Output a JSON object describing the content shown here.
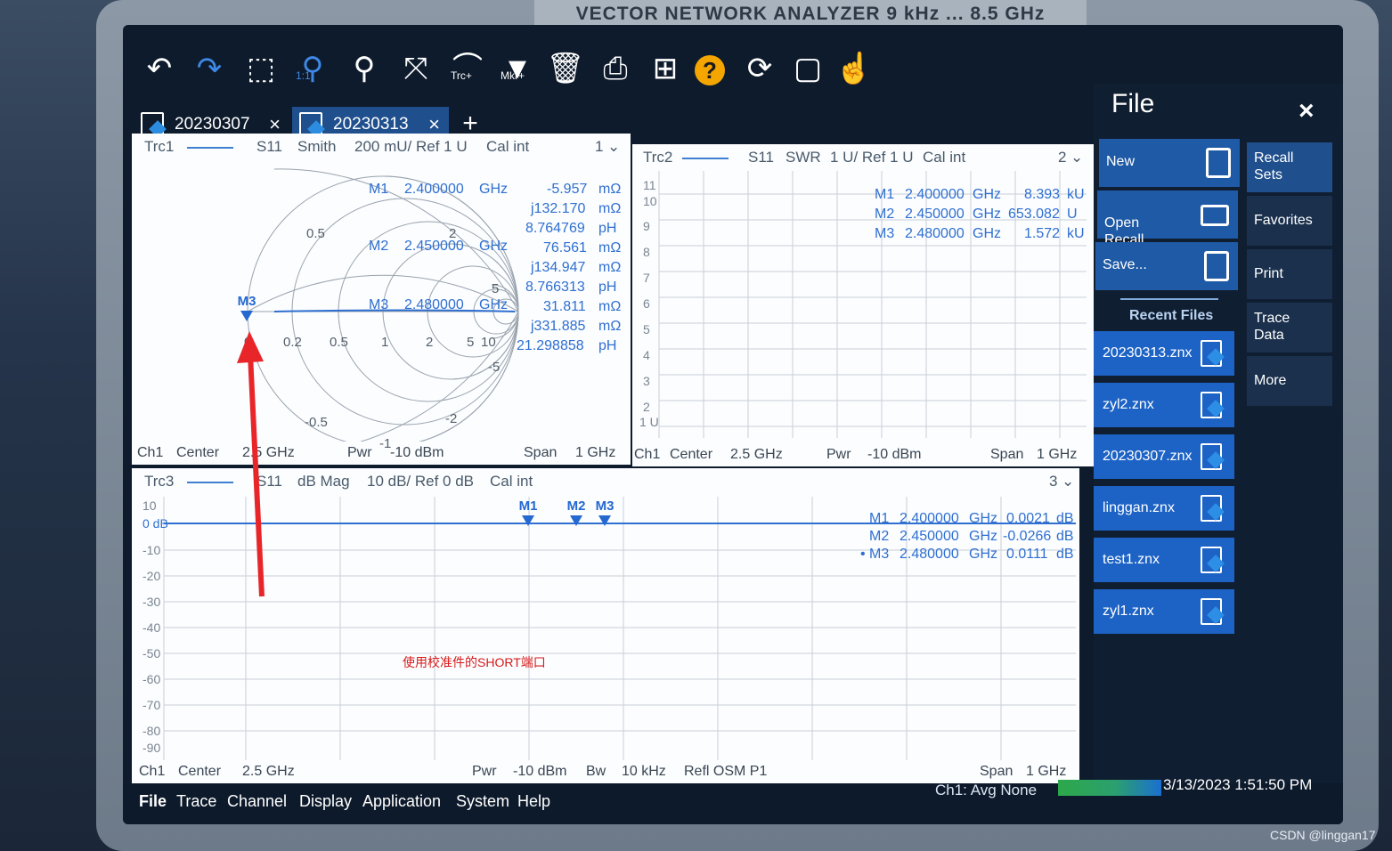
{
  "instrument_title": "VECTOR NETWORK ANALYZER  9 kHz ... 8.5 GHz",
  "toolbar": {
    "undo": "undo-icon",
    "redo": "redo-icon",
    "zoom_select": "zoom-select-icon",
    "zoom_reset": "zoom-reset-icon",
    "zoom_reset_label": "1:1",
    "zoom_settings": "zoom-settings-icon",
    "fullscreen": "fullscreen-icon",
    "trace_add_label": "Trc+",
    "marker_add_label": "Mkr+",
    "delete": "trash-icon",
    "print": "print-icon",
    "windows": "windows-icon",
    "help": "?",
    "refresh": "refresh-icon",
    "window": "window-icon",
    "touch": "touch-icon"
  },
  "tabs": [
    {
      "label": "20230307",
      "close": "×"
    },
    {
      "label": "20230313",
      "close": "×",
      "active": true
    }
  ],
  "tab_add": "+",
  "trc1": {
    "name": "Trc1",
    "meas": "S11",
    "format": "Smith",
    "scale": "200 mU/ Ref 1 U",
    "cal": "Cal int",
    "window": "1",
    "smith_labels": {
      "r0": "0",
      "r02": "0.2",
      "r05": "0.5",
      "r1": "1",
      "r2": "2",
      "r5": "5",
      "r10": "10",
      "x05": "0.5",
      "x2": "2",
      "x5": "5",
      "xm05": "-0.5",
      "xm2": "-2",
      "xm5": "-5",
      "xm1": "-1"
    },
    "markers": [
      {
        "name": "M1",
        "freq": "2.400000",
        "unit": "GHz",
        "r": "-5.957",
        "r_unit": "mΩ",
        "x": "j132.170",
        "x_unit": "mΩ",
        "l": "8.764769",
        "l_unit": "pH"
      },
      {
        "name": "M2",
        "freq": "2.450000",
        "unit": "GHz",
        "r": "76.561",
        "r_unit": "mΩ",
        "x": "j134.947",
        "x_unit": "mΩ",
        "l": "8.766313",
        "l_unit": "pH"
      },
      {
        "name": "M3",
        "freq": "2.480000",
        "unit": "GHz",
        "r": "31.811",
        "r_unit": "mΩ",
        "x": "j331.885",
        "x_unit": "mΩ",
        "l": "21.298858",
        "l_unit": "pH"
      }
    ],
    "marker_flag": "M3",
    "footer": {
      "ch": "Ch1",
      "center_label": "Center",
      "center": "2.5 GHz",
      "pwr_label": "Pwr",
      "pwr": "-10 dBm",
      "span_label": "Span",
      "span": "1 GHz"
    }
  },
  "trc2": {
    "name": "Trc2",
    "meas": "S11",
    "format": "SWR",
    "scale": "1 U/ Ref 1 U",
    "cal": "Cal int",
    "window": "2",
    "y_ticks": [
      "11",
      "10",
      "9",
      "8",
      "7",
      "6",
      "5",
      "4",
      "3",
      "2",
      "1 U"
    ],
    "markers": [
      {
        "name": "M1",
        "freq": "2.400000",
        "unit": "GHz",
        "value": "8.393",
        "v_unit": "kU"
      },
      {
        "name": "M2",
        "freq": "2.450000",
        "unit": "GHz",
        "value": "653.082",
        "v_unit": "U"
      },
      {
        "name": "M3",
        "freq": "2.480000",
        "unit": "GHz",
        "value": "1.572",
        "v_unit": "kU"
      }
    ],
    "footer": {
      "ch": "Ch1",
      "center_label": "Center",
      "center": "2.5 GHz",
      "pwr_label": "Pwr",
      "pwr": "-10 dBm",
      "span_label": "Span",
      "span": "1 GHz"
    }
  },
  "trc3": {
    "name": "Trc3",
    "meas": "S11",
    "format": "dB Mag",
    "scale": "10 dB/ Ref 0 dB",
    "cal": "Cal int",
    "window": "3",
    "y_ticks": [
      "10",
      "0 dB",
      "-10",
      "-20",
      "-30",
      "-40",
      "-50",
      "-60",
      "-70",
      "-80",
      "-90"
    ],
    "marker_flags": [
      "M1",
      "M2",
      "M3"
    ],
    "markers": [
      {
        "name": "M1",
        "freq": "2.400000",
        "unit": "GHz",
        "value": "0.0021",
        "v_unit": "dB"
      },
      {
        "name": "M2",
        "freq": "2.450000",
        "unit": "GHz",
        "value": "-0.0266",
        "v_unit": "dB"
      },
      {
        "name": "M3",
        "freq": "2.480000",
        "unit": "GHz",
        "value": "0.0111",
        "v_unit": "dB",
        "active": "•"
      }
    ],
    "footer": {
      "ch": "Ch1",
      "center_label": "Center",
      "center": "2.5 GHz",
      "pwr_label": "Pwr",
      "pwr": "-10 dBm",
      "bw_label": "Bw",
      "bw": "10 kHz",
      "refl": "Refl OSM P1",
      "span_label": "Span",
      "span": "1 GHz"
    }
  },
  "annotation": "使用校准件的SHORT端口",
  "file_panel": {
    "title": "File",
    "close": "×",
    "new": "New",
    "open": "Open\nRecall...",
    "save": "Save...",
    "recent_header": "Recent Files",
    "recent_files": [
      "20230313.znx",
      "zyl2.znx",
      "20230307.znx",
      "linggan.znx",
      "test1.znx",
      "zyl1.znx"
    ],
    "right_buttons": [
      "Recall\nSets",
      "Favorites",
      "Print",
      "Trace\nData",
      "More"
    ]
  },
  "menubar": [
    "File",
    "Trace",
    "Channel",
    "Display",
    "Application",
    "System",
    "Help"
  ],
  "status": {
    "avg": "Ch1: Avg None",
    "datetime": "3/13/2023 1:51:50 PM"
  },
  "watermark": "CSDN @linggan17",
  "colors": {
    "accent": "#1f5aa6",
    "trace": "#2f6fd0",
    "annotation": "#d81818",
    "status_bar": "#2ca84a"
  }
}
